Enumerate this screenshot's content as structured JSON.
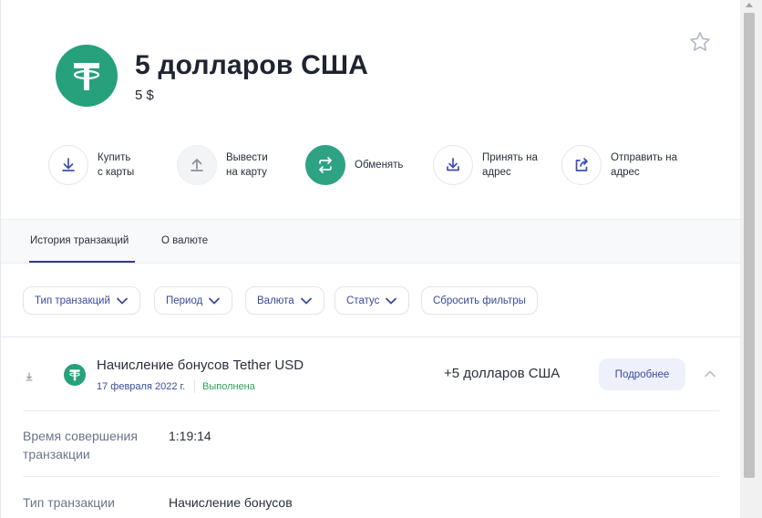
{
  "header": {
    "title": "5 долларов США",
    "balance": "5 $",
    "coin_logo": "tether-logo",
    "favorite_icon": "star-outline-icon"
  },
  "actions": [
    {
      "label": "Купить\nс карты",
      "icon": "download-icon",
      "style": "outline"
    },
    {
      "label": "Вывести\nна карту",
      "icon": "upload-icon",
      "style": "gray"
    },
    {
      "label": "Обменять",
      "icon": "exchange-icon",
      "style": "green"
    },
    {
      "label": "Принять на\nадрес",
      "icon": "receive-icon",
      "style": "outline"
    },
    {
      "label": "Отправить на\nадрес",
      "icon": "share-icon",
      "style": "outline"
    }
  ],
  "tabs": [
    {
      "label": "История транзакций",
      "active": true
    },
    {
      "label": "О валюте",
      "active": false
    }
  ],
  "filters": {
    "type": "Тип транзакций",
    "period": "Период",
    "currency": "Валюта",
    "status": "Статус",
    "reset": "Сбросить фильтры"
  },
  "transaction": {
    "title": "Начисление бонусов Tether USD",
    "date": "17 февраля 2022 г.",
    "status": "Выполнена",
    "amount": "+5 долларов США",
    "details_button": "Подробнее",
    "details": [
      {
        "label": "Время совершения\nтранзакции",
        "value": "1:19:14"
      },
      {
        "label": "Тип транзакции",
        "value": "Начисление бонусов"
      }
    ]
  },
  "colors": {
    "tether_green": "#26a17b",
    "accent_blue": "#3a4a9c",
    "status_green": "#2ea060"
  }
}
